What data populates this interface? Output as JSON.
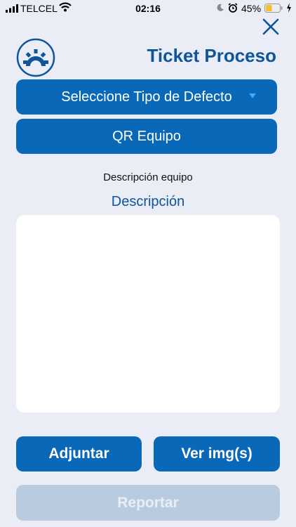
{
  "status_bar": {
    "carrier": "TELCEL",
    "time": "02:16",
    "battery_percent": "45%",
    "battery_level": 0.45,
    "battery_color": "#f6c02c"
  },
  "header": {
    "title": "Ticket Proceso",
    "close_icon": "close-icon",
    "logo_icon": "gear-logo-icon"
  },
  "form": {
    "defect_select_label": "Seleccione Tipo de Defecto",
    "qr_button_label": "QR Equipo",
    "equipment_description_label": "Descripción equipo",
    "description_heading": "Descripción",
    "description_value": ""
  },
  "actions": {
    "attach_label": "Adjuntar",
    "view_images_label": "Ver img(s)",
    "report_label": "Reportar"
  },
  "colors": {
    "primary": "#0a68b8",
    "title": "#0e5599",
    "background": "#eaedf5",
    "disabled": "#b9cbdf"
  }
}
